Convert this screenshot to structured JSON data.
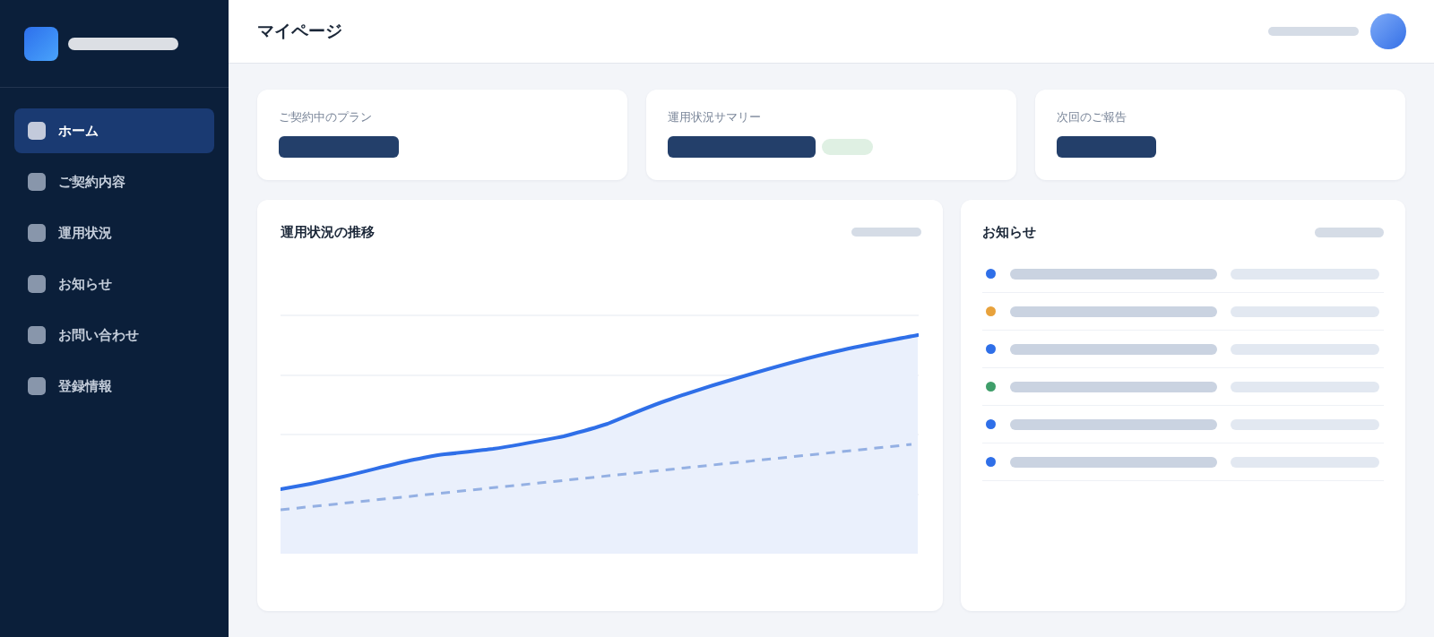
{
  "sidebar": {
    "nav_items": [
      {
        "label": "ホーム",
        "selected": true
      },
      {
        "label": "ご契約内容",
        "selected": false
      },
      {
        "label": "運用状況",
        "selected": false
      },
      {
        "label": "お知らせ",
        "selected": false
      },
      {
        "label": "お問い合わせ",
        "selected": false
      },
      {
        "label": "登録情報",
        "selected": false
      }
    ]
  },
  "header": {
    "title": "マイページ"
  },
  "summary_cards": [
    {
      "label": "ご契約中のプラン",
      "badge": false
    },
    {
      "label": "運用状況サマリー",
      "badge": true
    },
    {
      "label": "次回のご報告",
      "badge": false
    }
  ],
  "trend_panel": {
    "title": "運用状況の推移"
  },
  "news_panel": {
    "title": "お知らせ",
    "items": [
      {
        "color": "#2f6fe8"
      },
      {
        "color": "#e8a23c"
      },
      {
        "color": "#2f6fe8"
      },
      {
        "color": "#3f9e6a"
      },
      {
        "color": "#2f6fe8"
      },
      {
        "color": "#2f6fe8"
      }
    ]
  }
}
